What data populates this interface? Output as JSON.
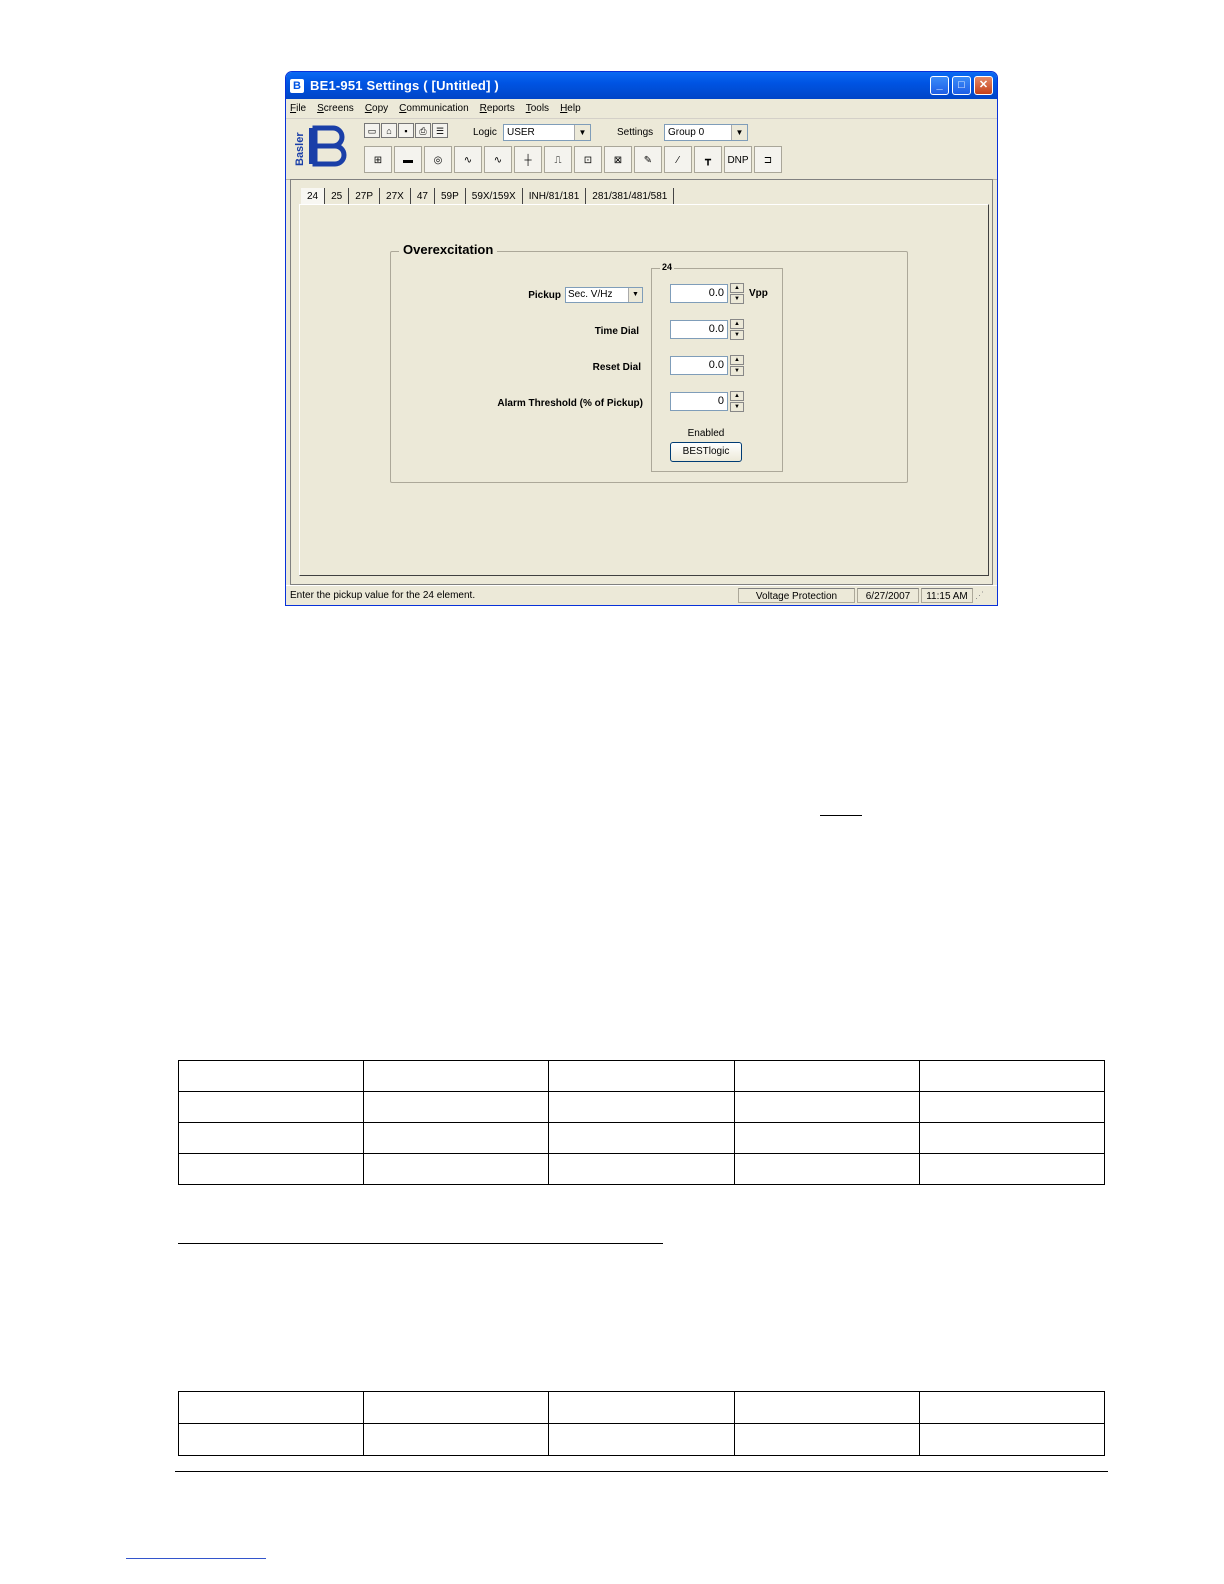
{
  "window": {
    "title": "BE1-951 Settings   ( [Untitled] )",
    "app_icon_glyph": "B",
    "min_glyph": "_",
    "max_glyph": "□",
    "close_glyph": "✕"
  },
  "menu": [
    "File",
    "Screens",
    "Copy",
    "Communication",
    "Reports",
    "Tools",
    "Help"
  ],
  "toolbar": {
    "logo_text": "Basler",
    "logic_label": "Logic",
    "logic_value": "USER",
    "settings_label": "Settings",
    "settings_value": "Group 0",
    "dnp_label": "DNP",
    "small_icons": [
      "new-file-icon",
      "open-folder-icon",
      "save-icon",
      "print-icon",
      "properties-icon"
    ],
    "large_icons": [
      "general-settings-icon",
      "communication-icon",
      "counter-icon",
      "overcurrent-icon",
      "voltage-icon",
      "phase-angle-icon",
      "reclose-icon",
      "breaker-icon",
      "timer-icon",
      "alarm-icon",
      "impedance-icon",
      "test-icon",
      "dnp-icon",
      "logic-gate-icon"
    ]
  },
  "tabs": [
    "24",
    "25",
    "27P",
    "27X",
    "47",
    "59P",
    "59X/159X",
    "INH/81/181",
    "281/381/481/581"
  ],
  "active_tab": "24",
  "overexcitation": {
    "group_title": "Overexcitation",
    "subgroup_title": "24",
    "pickup_label": "Pickup",
    "pickup_mode": "Sec. V/Hz",
    "pickup_value": "0.0",
    "pickup_unit": "Vpp",
    "time_dial_label": "Time Dial",
    "time_dial_value": "0.0",
    "reset_dial_label": "Reset Dial",
    "reset_dial_value": "0.0",
    "alarm_label": "Alarm Threshold (% of Pickup)",
    "alarm_value": "0",
    "status_label": "Enabled",
    "bestlogic_button": "BESTlogic"
  },
  "statusbar": {
    "message": "Enter the pickup value for the 24 element.",
    "section": "Voltage Protection",
    "date": "6/27/2007",
    "time": "11:15 AM"
  }
}
